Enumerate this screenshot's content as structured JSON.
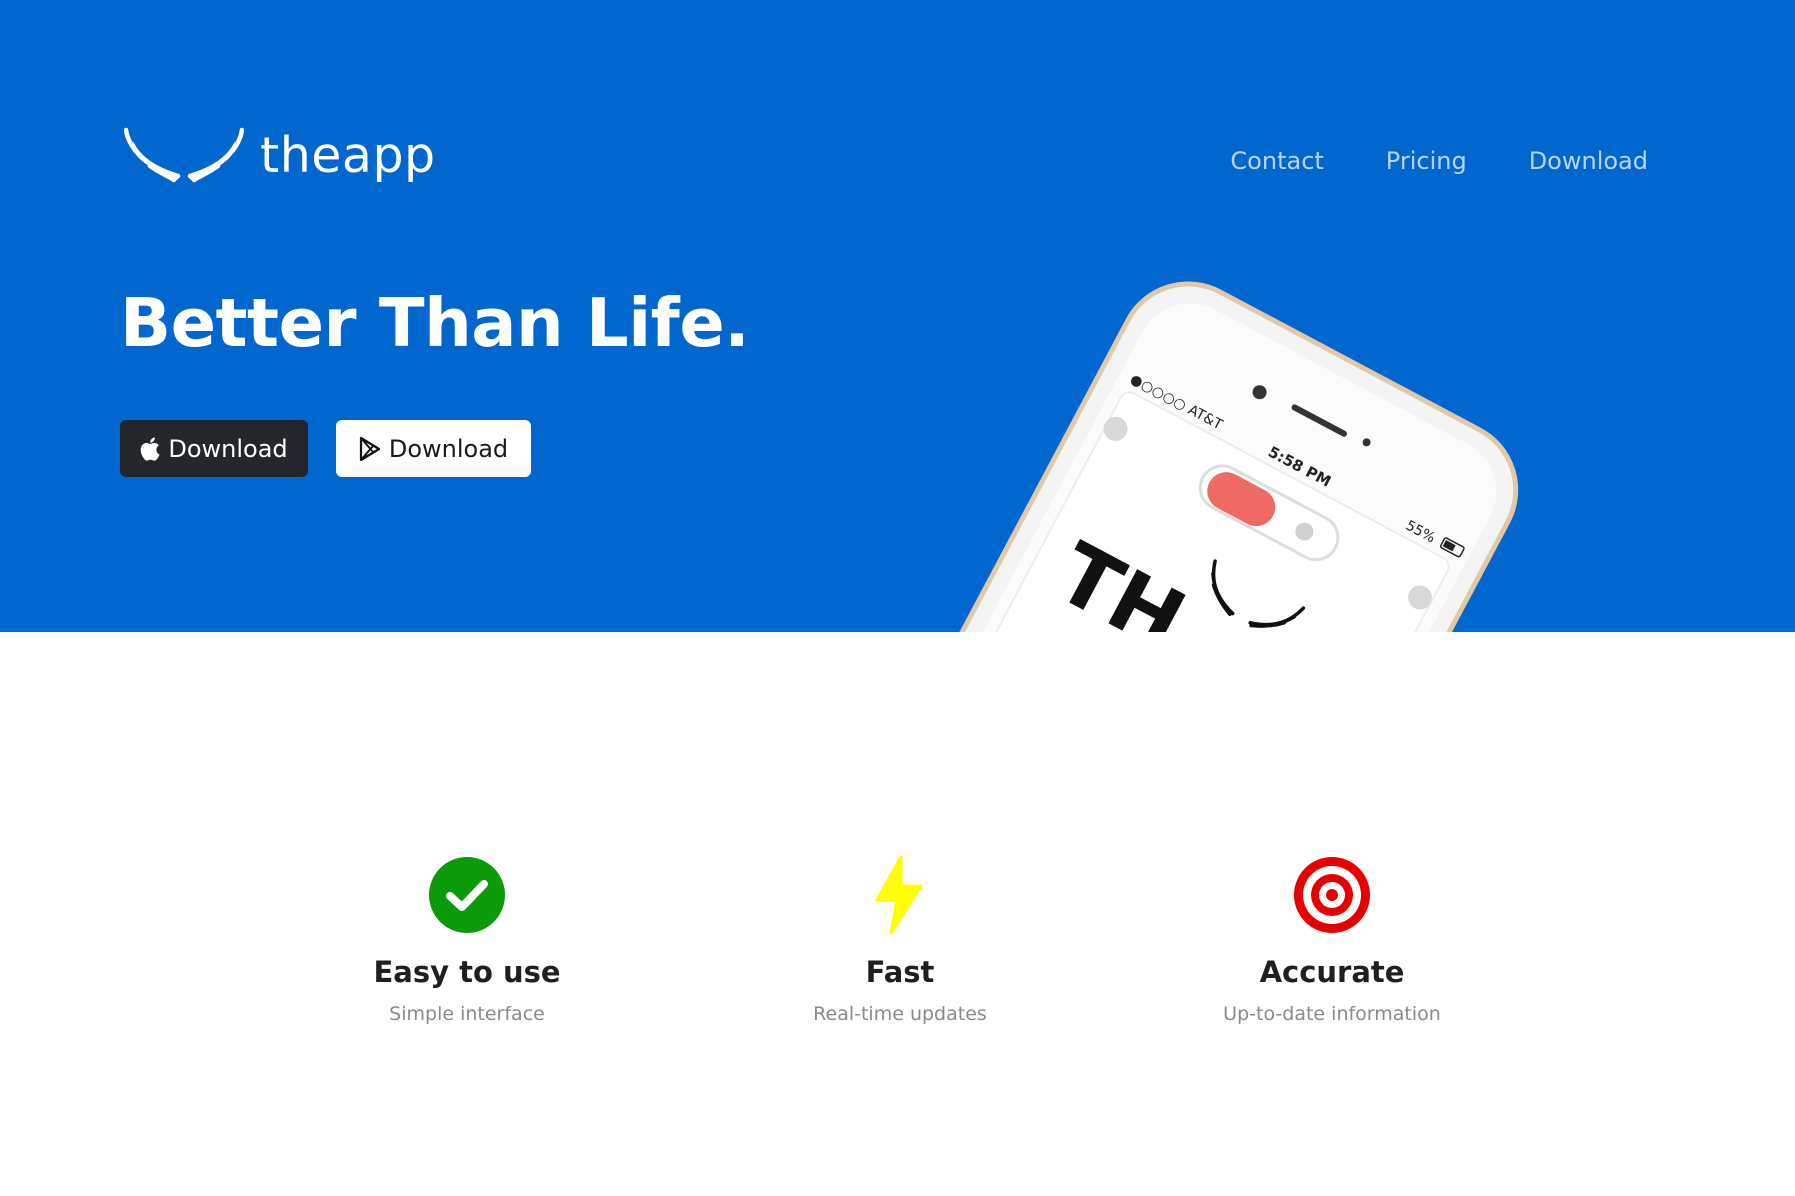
{
  "brand": {
    "name": "theapp",
    "logo_icon": "wings-icon"
  },
  "nav": {
    "items": [
      "Contact",
      "Pricing",
      "Download"
    ]
  },
  "hero": {
    "headline": "Better Than Life.",
    "buttons": [
      {
        "label": "Download",
        "icon": "apple-icon"
      },
      {
        "label": "Download",
        "icon": "google-play-icon"
      }
    ]
  },
  "phone": {
    "carrier": "●○○○○ AT&T",
    "time": "5:58 PM",
    "battery": "55%",
    "screen_text": "TH"
  },
  "features": [
    {
      "icon": "checkmark-circle-icon",
      "title": "Easy to use",
      "subtitle": "Simple interface",
      "color": "#0a9a0a"
    },
    {
      "icon": "lightning-bolt-icon",
      "title": "Fast",
      "subtitle": "Real-time updates",
      "color": "#ffff00"
    },
    {
      "icon": "target-icon",
      "title": "Accurate",
      "subtitle": "Up-to-date information",
      "color": "#e60000"
    }
  ],
  "colors": {
    "hero_background": "#0167cf",
    "dark_button": "#23272b"
  }
}
